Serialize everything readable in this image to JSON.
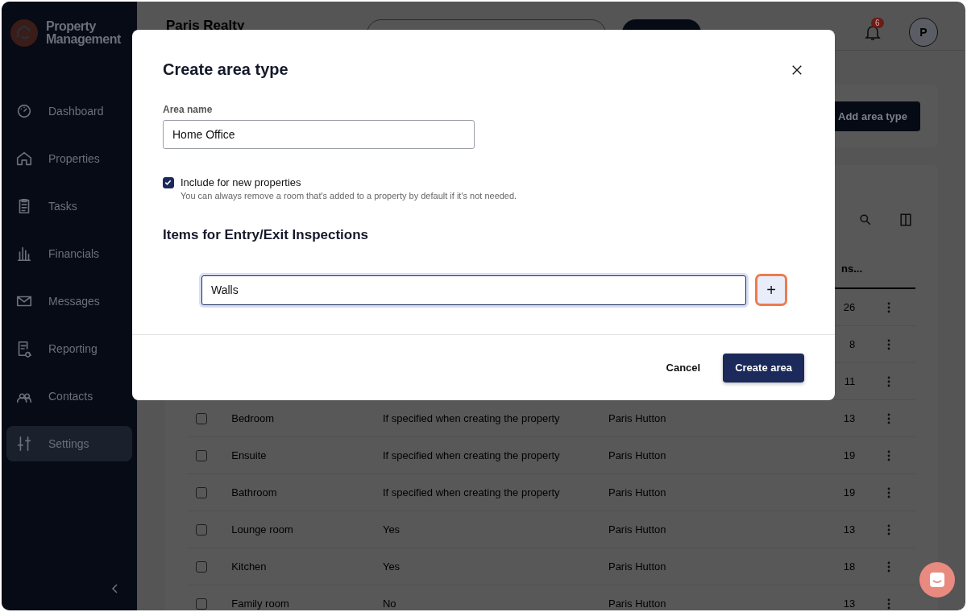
{
  "brand": {
    "name": "Property Management"
  },
  "sidebar": {
    "items": [
      {
        "label": "Dashboard",
        "selected": false
      },
      {
        "label": "Properties",
        "selected": false
      },
      {
        "label": "Tasks",
        "selected": false
      },
      {
        "label": "Financials",
        "selected": false
      },
      {
        "label": "Messages",
        "selected": false
      },
      {
        "label": "Reporting",
        "selected": false
      },
      {
        "label": "Contacts",
        "selected": false
      },
      {
        "label": "Settings",
        "selected": true
      }
    ]
  },
  "topbar": {
    "title": "Paris Realty",
    "notifications": "6",
    "avatar": "P"
  },
  "toolbar": {
    "add_button": "Add area type"
  },
  "table": {
    "column_4_header": "ns...",
    "rows": [
      {
        "count": "26"
      },
      {
        "count": "8"
      },
      {
        "count": "11"
      },
      {
        "name": "Bedroom",
        "default": "If specified when creating the property",
        "created_by": "Paris Hutton",
        "count": "13",
        "checked": false
      },
      {
        "name": "Ensuite",
        "default": "If specified when creating the property",
        "created_by": "Paris Hutton",
        "count": "19",
        "checked": false
      },
      {
        "name": "Bathroom",
        "default": "If specified when creating the property",
        "created_by": "Paris Hutton",
        "count": "19",
        "checked": false
      },
      {
        "name": "Lounge room",
        "default": "Yes",
        "created_by": "Paris Hutton",
        "count": "13",
        "checked": false
      },
      {
        "name": "Kitchen",
        "default": "Yes",
        "created_by": "Paris Hutton",
        "count": "18",
        "checked": false
      },
      {
        "name": "Family room",
        "default": "No",
        "created_by": "Paris Hutton",
        "count": "13",
        "checked": false
      }
    ]
  },
  "dialog": {
    "title": "Create area type",
    "name_label": "Area name",
    "name_value": "Home Office",
    "include": {
      "label": "Include for new properties",
      "hint": "You can always remove a room that's added to a property by default if it's not needed.",
      "checked": true
    },
    "items_heading": "Items for Entry/Exit Inspections",
    "item_value": "Walls",
    "add_item": "+",
    "cancel": "Cancel",
    "submit": "Create area"
  }
}
